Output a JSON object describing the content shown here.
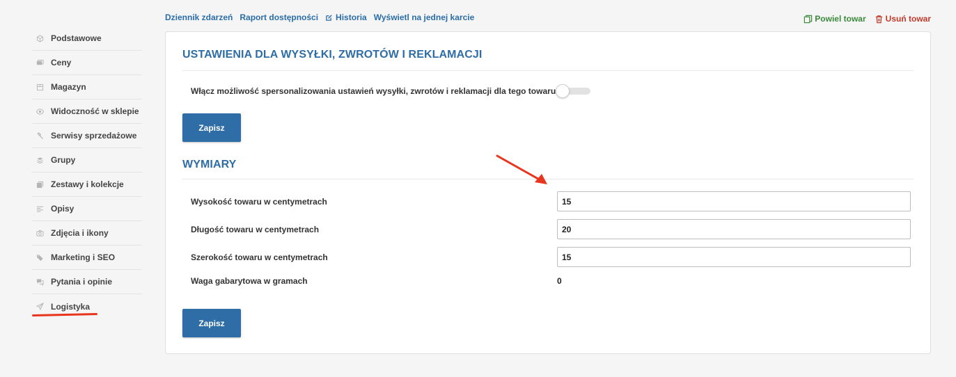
{
  "top_links": {
    "event_log": "Dziennik zdarzeń",
    "availability_report": "Raport dostępności",
    "history": "Historia",
    "single_card": "Wyświetl na jednej karcie"
  },
  "top_actions": {
    "duplicate": "Powiel towar",
    "delete": "Usuń towar"
  },
  "sidebar": {
    "items": [
      {
        "label": "Podstawowe",
        "icon": "cube-icon"
      },
      {
        "label": "Ceny",
        "icon": "price-icon"
      },
      {
        "label": "Magazyn",
        "icon": "warehouse-icon"
      },
      {
        "label": "Widoczność w sklepie",
        "icon": "eye-icon"
      },
      {
        "label": "Serwisy sprzedażowe",
        "icon": "hammer-icon"
      },
      {
        "label": "Grupy",
        "icon": "layers-icon"
      },
      {
        "label": "Zestawy i kolekcje",
        "icon": "collection-icon"
      },
      {
        "label": "Opisy",
        "icon": "text-icon"
      },
      {
        "label": "Zdjęcia i ikony",
        "icon": "camera-icon"
      },
      {
        "label": "Marketing i SEO",
        "icon": "tag-icon"
      },
      {
        "label": "Pytania i opinie",
        "icon": "comments-icon"
      },
      {
        "label": "Logistyka",
        "icon": "send-icon"
      }
    ]
  },
  "shipping": {
    "title": "USTAWIENIA DLA WYSYŁKI, ZWROTÓW I REKLAMACJI",
    "toggle_label": "Włącz możliwość spersonalizowania ustawień wysyłki, zwrotów i reklamacji dla tego towaru",
    "toggle_on": false,
    "save_label": "Zapisz"
  },
  "dimensions": {
    "title": "WYMIARY",
    "height_label": "Wysokość towaru w centymetrach",
    "height_value": "15",
    "length_label": "Długość towaru w centymetrach",
    "length_value": "20",
    "width_label": "Szerokość towaru w centymetrach",
    "width_value": "15",
    "weight_label": "Waga gabarytowa w gramach",
    "weight_value": "0",
    "save_label": "Zapisz"
  },
  "colors": {
    "accent": "#2f6da6",
    "green": "#3c8a3c",
    "red": "#c0392b",
    "annotation": "#e8351d"
  }
}
